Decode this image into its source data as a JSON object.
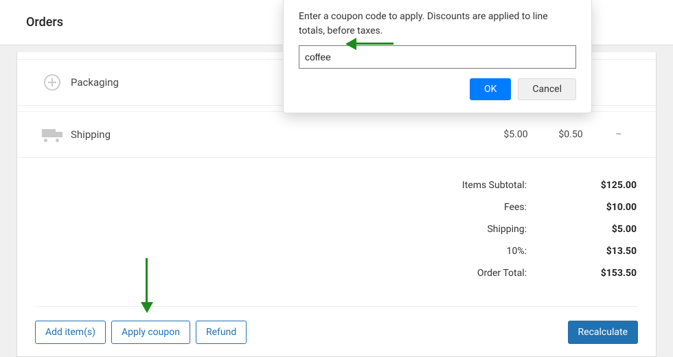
{
  "header": {
    "title": "Orders"
  },
  "rows": {
    "packaging": {
      "label": "Packaging"
    },
    "shipping": {
      "label": "Shipping",
      "amount": "$5.00",
      "tax": "$0.50",
      "dash": "–"
    }
  },
  "totals": {
    "items_subtotal": {
      "label": "Items Subtotal:",
      "value": "$125.00"
    },
    "fees": {
      "label": "Fees:",
      "value": "$10.00"
    },
    "shipping": {
      "label": "Shipping:",
      "value": "$5.00"
    },
    "tax": {
      "label": "10%:",
      "value": "$13.50"
    },
    "order_total": {
      "label": "Order Total:",
      "value": "$153.50"
    }
  },
  "actions": {
    "add_items": "Add item(s)",
    "apply_coupon": "Apply coupon",
    "refund": "Refund",
    "recalculate": "Recalculate"
  },
  "modal": {
    "prompt": "Enter a coupon code to apply. Discounts are applied to line totals, before taxes.",
    "value": "coffee",
    "ok": "OK",
    "cancel": "Cancel"
  }
}
